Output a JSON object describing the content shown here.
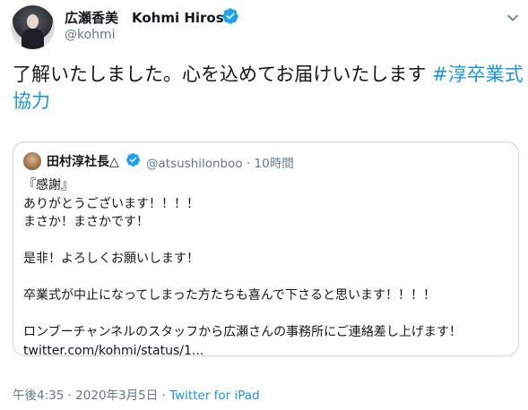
{
  "tweet": {
    "display_name": "広瀬香美　Kohmi Hirose",
    "handle": "@kohmi",
    "text": "了解いたしました。心を込めてお届けいたします ",
    "hashtag": "#淳卒業式協力",
    "time": "午後4:35",
    "separator": " · ",
    "date": "2020年3月5日",
    "separator2": " · ",
    "source": "Twitter for iPad"
  },
  "quoted": {
    "display_name": "田村淳社長△",
    "handle_time": "@atsushilonboo · 10時間",
    "lines": [
      "『感謝』",
      "ありがとうございます！！！！",
      "まさか！まさかです！",
      "",
      "是非！よろしくお願いします！",
      "",
      "卒業式が中止になってしまった方たちも喜んで下さると思います！！！！",
      "",
      "ロンブーチャンネルのスタッフから広瀬さんの事務所にご連絡差し上げます！"
    ],
    "link": "twitter.com/kohmi/status/1..."
  },
  "colors": {
    "accent": "#1b95e0",
    "verified": "#1da1f2",
    "muted": "#657786"
  },
  "icons": {
    "verified": "verified-badge-icon",
    "chevron": "chevron-down-icon"
  }
}
